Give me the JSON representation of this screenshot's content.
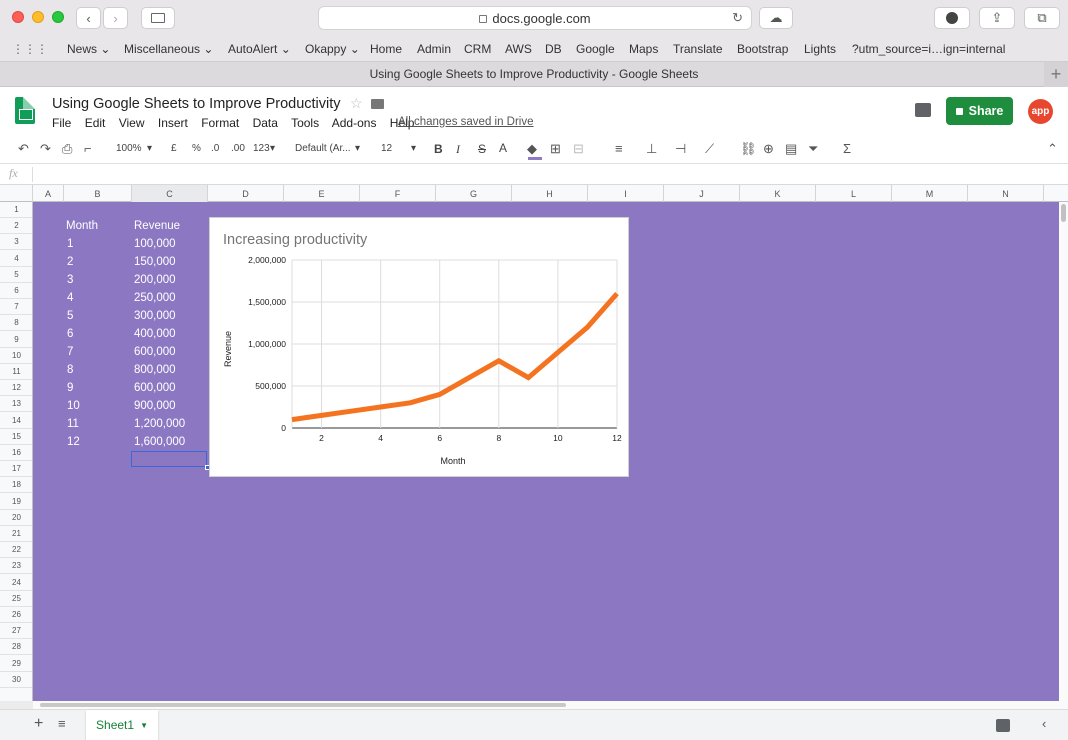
{
  "browser": {
    "url": "docs.google.com",
    "tab_title": "Using Google Sheets to Improve Productivity - Google Sheets",
    "bookmarks": [
      "News ⌄",
      "Miscellaneous ⌄",
      "AutoAlert ⌄",
      "Okappy ⌄",
      "Home",
      "Admin",
      "CRM",
      "AWS",
      "DB",
      "Google",
      "Maps",
      "Translate",
      "Bootstrap",
      "Lights",
      "?utm_source=i…ign=internal"
    ]
  },
  "doc": {
    "title": "Using Google Sheets to Improve Productivity",
    "menu": [
      "File",
      "Edit",
      "View",
      "Insert",
      "Format",
      "Data",
      "Tools",
      "Add-ons",
      "Help"
    ],
    "saved_status": "All changes saved in Drive",
    "share_label": "Share",
    "avatar_text": "app"
  },
  "toolbar": {
    "zoom": "100%",
    "currency": "£",
    "percent": "%",
    "dec_less": ".0",
    "dec_more": ".00",
    "format_more": "123",
    "font": "Default (Ar...",
    "font_size": "12",
    "bold": "B",
    "italic": "I",
    "strike": "S",
    "text_color": "A",
    "fill_color_hex": "#8e7bc4"
  },
  "formula_bar": {
    "fx": "fx",
    "value": ""
  },
  "grid": {
    "columns": [
      "A",
      "B",
      "C",
      "D",
      "E",
      "F",
      "G",
      "H",
      "I",
      "J",
      "K",
      "L",
      "M",
      "N"
    ],
    "rows": [
      "1",
      "2",
      "3",
      "4",
      "5",
      "6",
      "7",
      "8",
      "9",
      "10",
      "11",
      "12",
      "13",
      "14",
      "15",
      "16",
      "17",
      "18",
      "19",
      "20",
      "21",
      "22",
      "23",
      "24",
      "25",
      "26",
      "27",
      "28",
      "29",
      "30"
    ],
    "background_hex": "#8c78c2",
    "selected_cell": "C15",
    "headers": {
      "month": "Month",
      "revenue": "Revenue"
    },
    "months": [
      "1",
      "2",
      "3",
      "4",
      "5",
      "6",
      "7",
      "8",
      "9",
      "10",
      "11",
      "12"
    ],
    "revenues": [
      "100,000",
      "150,000",
      "200,000",
      "250,000",
      "300,000",
      "400,000",
      "600,000",
      "800,000",
      "600,000",
      "900,000",
      "1,200,000",
      "1,600,000"
    ]
  },
  "chart_data": {
    "type": "line",
    "title": "Increasing productivity",
    "xlabel": "Month",
    "ylabel": "Revenue",
    "x": [
      1,
      2,
      3,
      4,
      5,
      6,
      7,
      8,
      9,
      10,
      11,
      12
    ],
    "series": [
      {
        "values": [
          100000,
          150000,
          200000,
          250000,
          300000,
          400000,
          600000,
          800000,
          600000,
          900000,
          1200000,
          1600000
        ],
        "color": "#f47321"
      }
    ],
    "xlim": [
      1,
      12
    ],
    "ylim": [
      0,
      2000000
    ],
    "x_ticks": [
      "2",
      "4",
      "6",
      "8",
      "10",
      "12"
    ],
    "y_ticks": [
      "0",
      "500,000",
      "1,000,000",
      "1,500,000",
      "2,000,000"
    ],
    "grid": true,
    "legend": "none"
  },
  "sheets": {
    "active": "Sheet1"
  }
}
